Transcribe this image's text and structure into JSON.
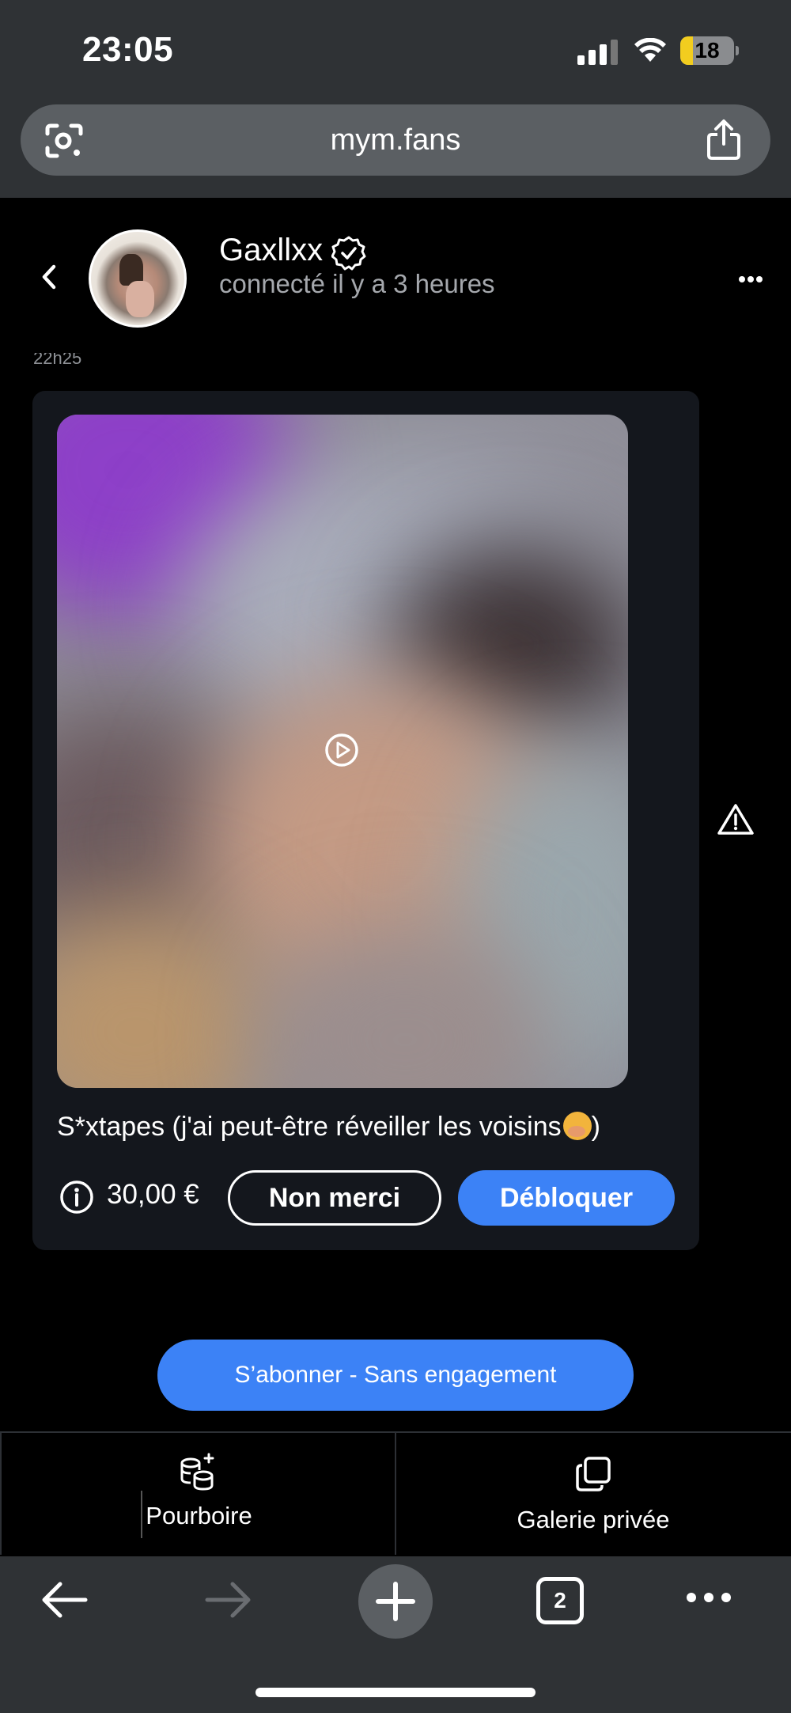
{
  "status_bar": {
    "time": "23:05",
    "battery": "18"
  },
  "browser": {
    "url": "mym.fans",
    "tab_count": "2"
  },
  "chat_header": {
    "username": "Gaxllxx",
    "status": "connecté il y a 3 heures"
  },
  "message": {
    "timestamp": "22h25",
    "caption": "S*xtapes (j'ai peut-être réveiller les voisins",
    "caption_end": ")",
    "price": "30,00 €",
    "decline_label": "Non merci",
    "unlock_label": "Débloquer"
  },
  "subscribe_label": "S’abonner - Sans engagement",
  "tabs": {
    "tip_label": "Pourboire",
    "gallery_label": "Galerie privée"
  },
  "colors": {
    "accent": "#3c82f6",
    "chrome": "#2f3235",
    "card": "#14171d"
  }
}
